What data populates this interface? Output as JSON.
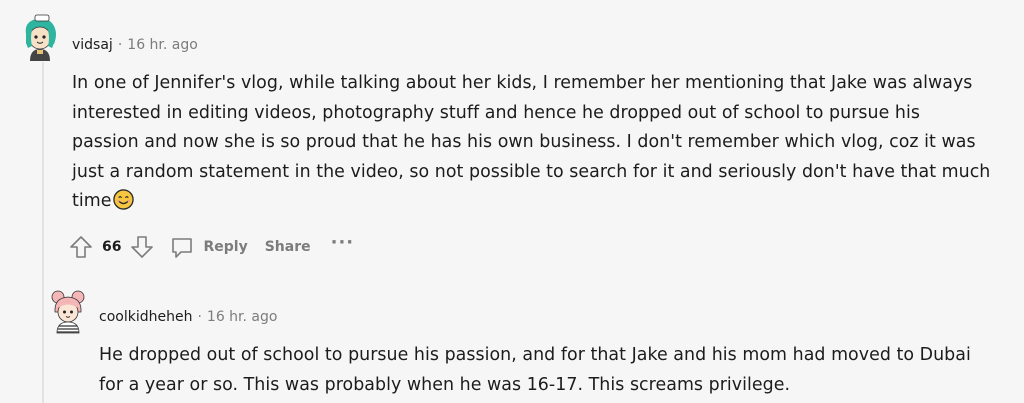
{
  "comment": {
    "username": "vidsaj",
    "separator": "·",
    "timestamp": "16 hr. ago",
    "body": "In one of Jennifer's vlog, while talking about her kids, I remember her mentioning that Jake was always interested in editing videos, photography stuff and hence he dropped out of school to pursue his passion and now she is so proud that he has his own business. I don't remember which vlog, coz it was just a random statement in the video, so not possible to search for it and seriously don't have that much time",
    "emoji": "smiling-face-emoji",
    "votes": "66",
    "reply_label": "Reply",
    "share_label": "Share",
    "more_label": "···"
  },
  "reply": {
    "username": "coolkidheheh",
    "separator": "·",
    "timestamp": "16 hr. ago",
    "body": "He dropped out of school to pursue his passion, and for that Jake and his mom had moved to Dubai for a year or so. This was probably when he was 16-17. This screams privilege."
  },
  "icons": {
    "upvote": "upvote-arrow-icon",
    "downvote": "downvote-arrow-icon",
    "reply": "speech-bubble-icon",
    "more": "ellipsis-icon"
  },
  "colors": {
    "background": "#f6f6f6",
    "text": "#1c1c1c",
    "meta": "#7c7c7c",
    "thread_line": "#e2e2e2",
    "avatar_teal": "#2fb4a0",
    "avatar_pink": "#f4b6b6"
  }
}
